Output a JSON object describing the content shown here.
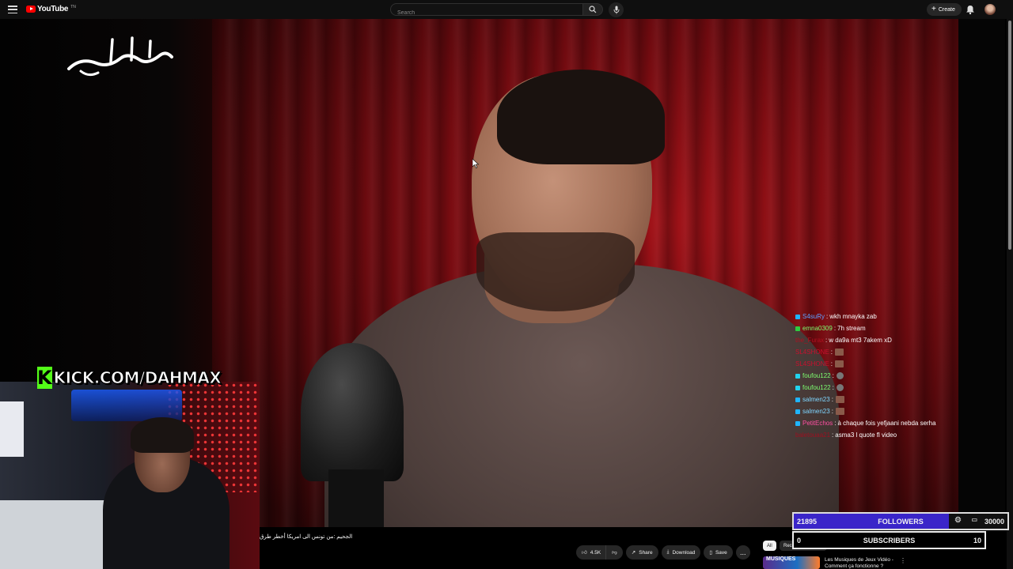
{
  "topbar": {
    "logo_text": "YouTube",
    "region": "TN",
    "search_placeholder": "Search",
    "create_label": "Create",
    "icons": [
      "menu-icon",
      "search-icon",
      "mic-icon",
      "bell-icon",
      "avatar"
    ]
  },
  "video": {
    "title": "الجحيم :من تونس الى امريكا أخطر طرق",
    "calligraphy": "حكايات",
    "overlay_banner": "KICK.COM/DAHMAX",
    "overlay_banner_letter": "K"
  },
  "chat": {
    "messages": [
      {
        "user": "S4suRy",
        "color": "#5ea0ff",
        "badge": "#1fb5ff",
        "text": "wkh mnayka zab",
        "emote": ""
      },
      {
        "user": "emna0309",
        "color": "#7dff70",
        "badge": "#2ecc40",
        "text": "7h stream",
        "emote": ""
      },
      {
        "user": "the_Furax",
        "color": "#b01020",
        "badge": "",
        "text": "w da9a mt3 7akem xD",
        "emote": ""
      },
      {
        "user": "SL4SHONE",
        "color": "#c8102e",
        "badge": "",
        "text": "",
        "emote": "img"
      },
      {
        "user": "SL4SHONE",
        "color": "#c8102e",
        "badge": "",
        "text": "",
        "emote": "img"
      },
      {
        "user": "foufou122",
        "color": "#7dff70",
        "badge": "#22d3ee",
        "text": "",
        "emote": "gray"
      },
      {
        "user": "foufou122",
        "color": "#7dff70",
        "badge": "#22d3ee",
        "text": "",
        "emote": "gray"
      },
      {
        "user": "salmen23",
        "color": "#7fd6ff",
        "badge": "#1fb5ff",
        "text": "",
        "emote": "img"
      },
      {
        "user": "salmen23",
        "color": "#7fd6ff",
        "badge": "#1fb5ff",
        "text": "",
        "emote": "img"
      },
      {
        "user": "PetitEchos",
        "color": "#ff4fa3",
        "badge": "#1fb5ff",
        "text": "à chaque fois yefjaani nebda serha",
        "emote": ""
      },
      {
        "user": "baletouaa21",
        "color": "#9c1020",
        "badge": "",
        "text": "asma3 l quote fl video",
        "emote": ""
      }
    ]
  },
  "stats": {
    "followers": {
      "current": "21895",
      "label": "FOLLOWERS",
      "goal": "30000"
    },
    "subscribers": {
      "current": "0",
      "label": "SUBSCRIBERS",
      "goal": "10"
    }
  },
  "actions": {
    "like_count": "4.5K",
    "share_label": "Share",
    "download_label": "Download",
    "save_label": "Save",
    "more_label": "..."
  },
  "chips": {
    "all": "All",
    "recent": "Recently uploaded"
  },
  "recommended": {
    "thumb_text": "MUSIQUES",
    "title": "Les Musiques de Jeux Vidéo - Comment ça fonctionne ?"
  },
  "colors": {
    "youtube_red": "#ff0000",
    "kick_green": "#53fc18",
    "followers_bar": "#3a25c9"
  }
}
